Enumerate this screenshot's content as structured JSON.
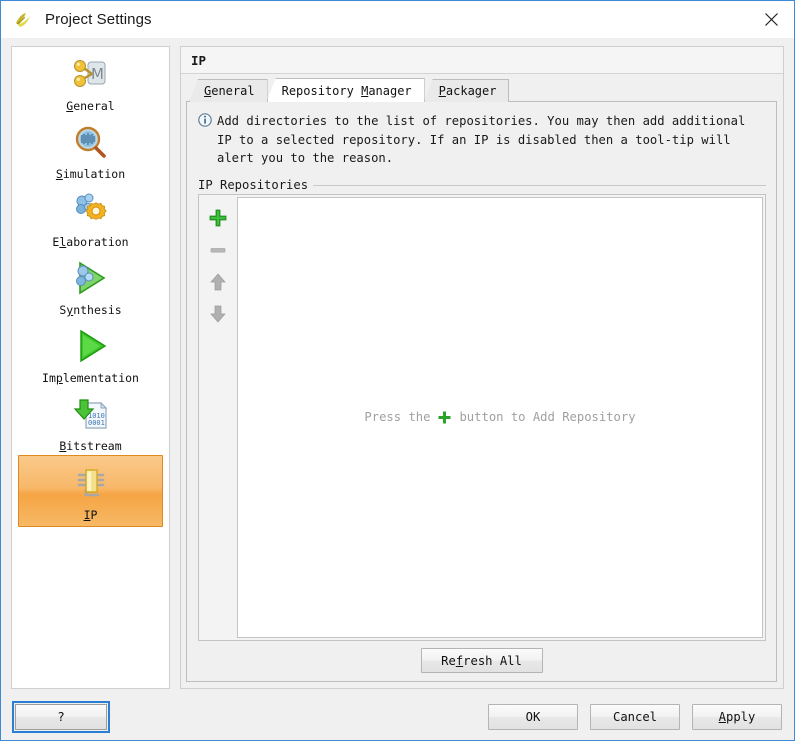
{
  "window": {
    "title": "Project Settings",
    "app_icon": "vivado-logo-icon",
    "close_label": "×"
  },
  "sidebar": {
    "items": [
      {
        "label": "General",
        "mnemonic": "G",
        "icon": "general-icon",
        "selected": false
      },
      {
        "label": "Simulation",
        "mnemonic": "S",
        "icon": "simulation-icon",
        "selected": false
      },
      {
        "label": "Elaboration",
        "mnemonic": "l",
        "icon": "elaboration-icon",
        "selected": false
      },
      {
        "label": "Synthesis",
        "mnemonic": "y",
        "icon": "synthesis-icon",
        "selected": false
      },
      {
        "label": "Implementation",
        "mnemonic": "p",
        "icon": "implementation-icon",
        "selected": false
      },
      {
        "label": "Bitstream",
        "mnemonic": "B",
        "icon": "bitstream-icon",
        "selected": false
      },
      {
        "label": "IP",
        "mnemonic": "I",
        "icon": "ip-icon",
        "selected": true
      }
    ]
  },
  "panel": {
    "header_title": "IP",
    "tabs": [
      {
        "label": "General",
        "mnemonic": "G",
        "selected": false
      },
      {
        "label": "Repository Manager",
        "mnemonic": "M",
        "selected": true
      },
      {
        "label": "Packager",
        "mnemonic": "P",
        "selected": false
      }
    ],
    "info": {
      "icon": "info-icon",
      "text": "Add directories to the list of repositories. You may then add additional\nIP to a selected repository. If an IP is disabled then a tool-tip will\nalert you to the reason."
    },
    "group": {
      "title": "IP Repositories",
      "toolbar": [
        {
          "name": "add-repository-button",
          "icon": "plus-icon",
          "enabled": true
        },
        {
          "name": "remove-repository-button",
          "icon": "minus-icon",
          "enabled": false
        },
        {
          "name": "move-up-button",
          "icon": "arrow-up-icon",
          "enabled": false
        },
        {
          "name": "move-down-button",
          "icon": "arrow-down-icon",
          "enabled": false
        }
      ],
      "empty_message_prefix": "Press the",
      "empty_message_suffix": "button to Add Repository",
      "empty_message_icon": "plus-icon",
      "rows": []
    },
    "refresh_button": {
      "label": "Refresh All",
      "mnemonic": "f"
    }
  },
  "footer": {
    "help_label": "?",
    "buttons": [
      {
        "label": "OK",
        "mnemonic": "",
        "name": "ok-button"
      },
      {
        "label": "Cancel",
        "mnemonic": "",
        "name": "cancel-button"
      },
      {
        "label": "Apply",
        "mnemonic": "A",
        "name": "apply-button"
      }
    ]
  },
  "colors": {
    "selection_orange": "#f5a545",
    "accent_green": "#2aa32a",
    "focus_blue": "#2a7fd4",
    "window_border": "#3d8bd6",
    "muted_text": "#a0a0a0"
  }
}
